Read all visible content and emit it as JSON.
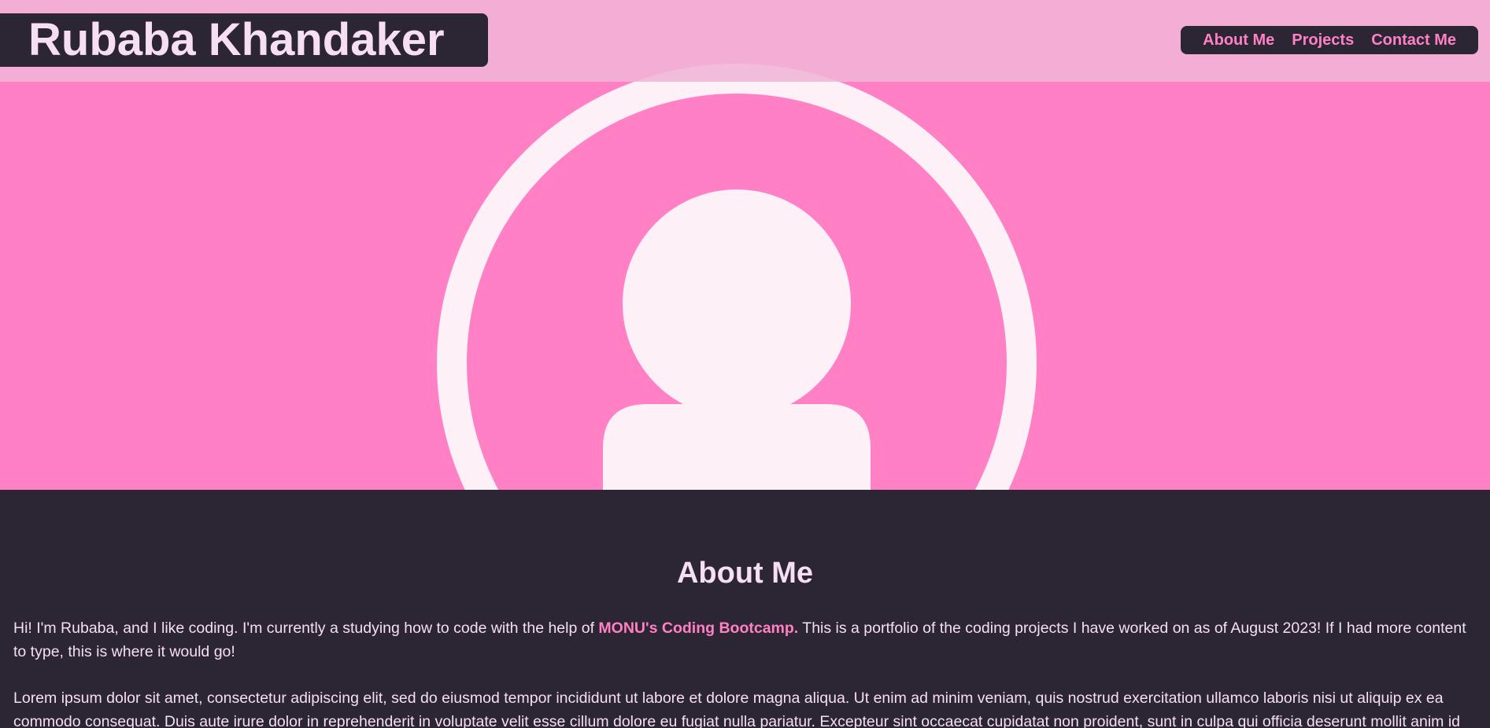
{
  "header": {
    "site_title": "Rubaba Khandaker",
    "nav": [
      "About Me",
      "Projects",
      "Contact Me"
    ]
  },
  "hero": {
    "icon": "user-avatar-icon"
  },
  "about": {
    "heading": "About Me",
    "intro_before": "Hi! I'm Rubaba, and I like coding. I'm currently a studying how to code with the help of ",
    "intro_highlight": "MONU's Coding Bootcamp.",
    "intro_after": " This is a portfolio of the coding projects I have worked on as of August 2023! If I had more content to type, this is where it would go!",
    "lorem": "Lorem ipsum dolor sit amet, consectetur adipiscing elit, sed do eiusmod tempor incididunt ut labore et dolore magna aliqua. Ut enim ad minim veniam, quis nostrud exercitation ullamco laboris nisi ut aliquip ex ea commodo consequat. Duis aute irure dolor in reprehenderit in voluptate velit esse cillum dolore eu fugiat nulla pariatur. Excepteur sint occaecat cupidatat non proident, sunt in culpa qui officia deserunt mollit anim id est laborum."
  },
  "colors": {
    "pink": "#ff80c5",
    "dark": "#2b2534",
    "light_text": "#f6dff0",
    "header_bg": "#f0b4d7"
  }
}
